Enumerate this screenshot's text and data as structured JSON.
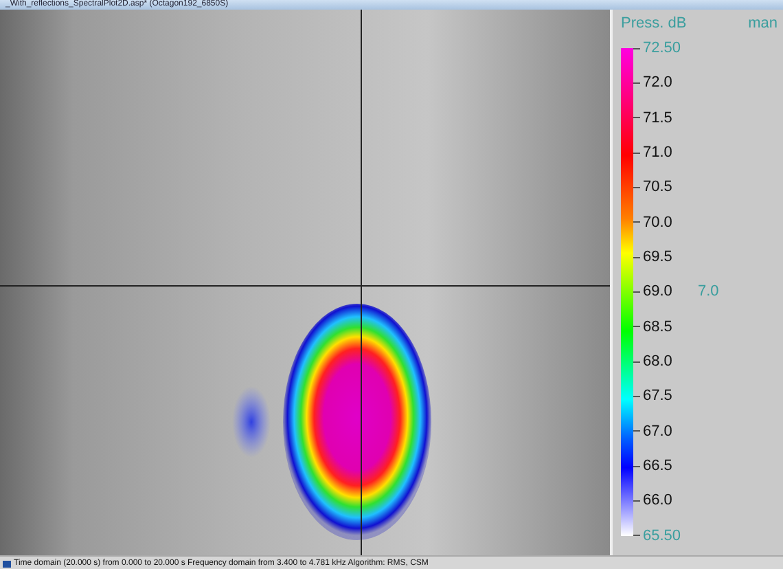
{
  "window": {
    "title": "_With_reflections_SpectralPlot2D.asp* (Octagon192_6850S)"
  },
  "legend": {
    "title": "Press. dB",
    "mode": "man",
    "ticks": [
      {
        "label": "72.50",
        "kind": "end"
      },
      {
        "label": "72.0",
        "kind": "tick"
      },
      {
        "label": "71.5",
        "kind": "tick"
      },
      {
        "label": "71.0",
        "kind": "tick"
      },
      {
        "label": "70.5",
        "kind": "tick"
      },
      {
        "label": "70.0",
        "kind": "tick"
      },
      {
        "label": "69.5",
        "kind": "tick"
      },
      {
        "label": "69.0",
        "kind": "tick",
        "note": "7.0"
      },
      {
        "label": "68.5",
        "kind": "tick"
      },
      {
        "label": "68.0",
        "kind": "tick"
      },
      {
        "label": "67.5",
        "kind": "tick"
      },
      {
        "label": "67.0",
        "kind": "tick"
      },
      {
        "label": "66.5",
        "kind": "tick"
      },
      {
        "label": "66.0",
        "kind": "tick"
      },
      {
        "label": "65.50",
        "kind": "end"
      }
    ]
  },
  "status_bar": {
    "text": "Time domain (20.000 s) from 0.000 to 20.000 s Frequency domain from 3.400 to 4.781 kHz Algorithm: RMS, CSM"
  }
}
